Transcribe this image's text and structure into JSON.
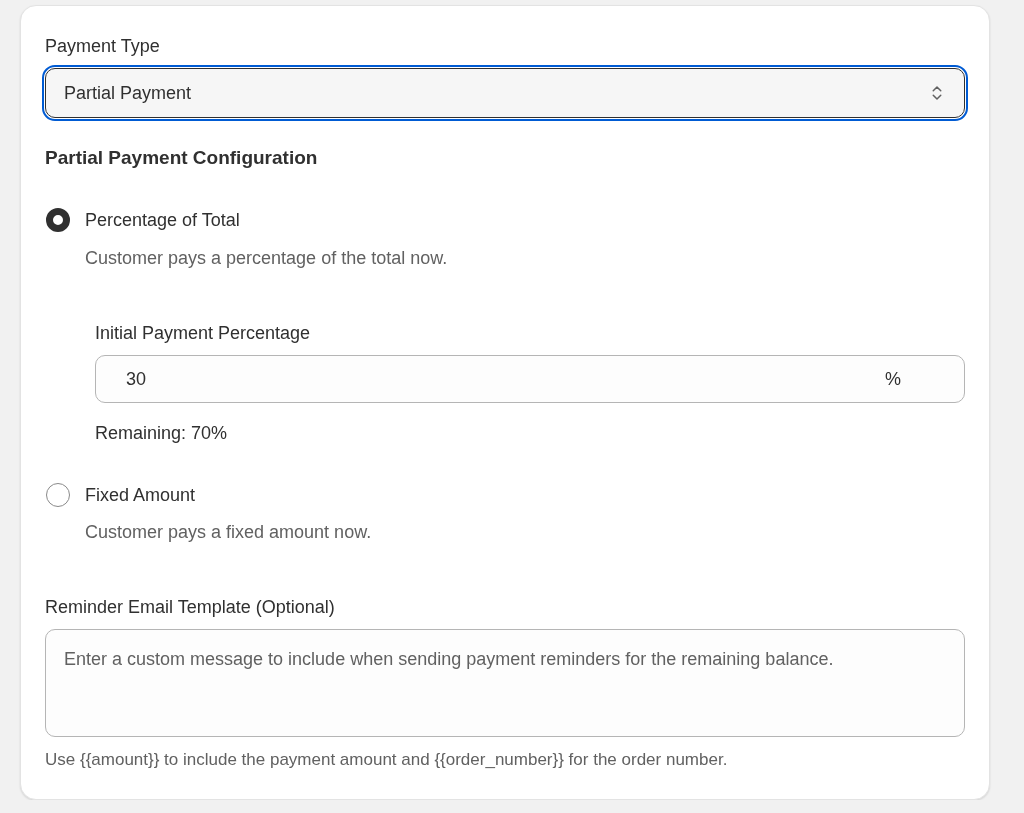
{
  "payment_type": {
    "label": "Payment Type",
    "value": "Partial Payment",
    "focused": true
  },
  "configuration": {
    "heading": "Partial Payment Configuration",
    "options": [
      {
        "label": "Percentage of Total",
        "description": "Customer pays a percentage of the total now.",
        "selected": true,
        "field": {
          "label": "Initial Payment Percentage",
          "value": "30",
          "suffix": "%",
          "remaining": "Remaining: 70%"
        }
      },
      {
        "label": "Fixed Amount",
        "description": "Customer pays a fixed amount now.",
        "selected": false
      }
    ]
  },
  "reminder": {
    "label": "Reminder Email Template (Optional)",
    "placeholder": "Enter a custom message to include when sending payment reminders for the remaining balance.",
    "help": "Use {{amount}} to include the payment amount and {{order_number}} for the order number."
  }
}
